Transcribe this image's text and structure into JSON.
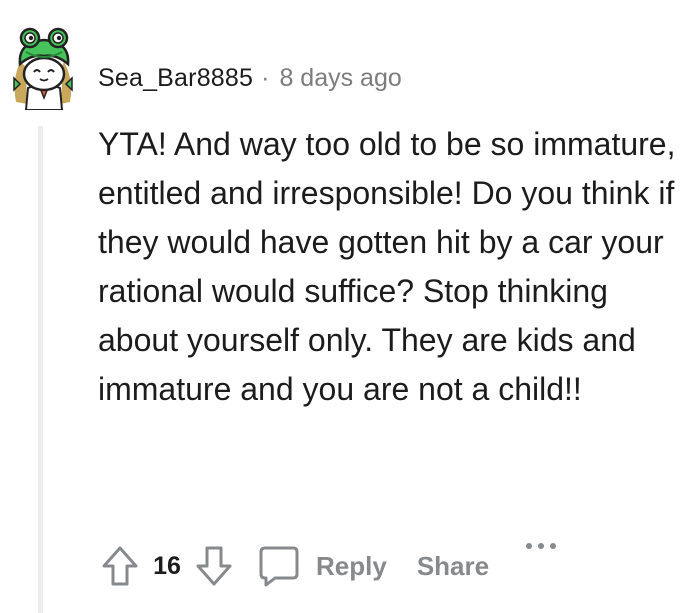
{
  "comment": {
    "author": "Sea_Bar8885",
    "separator": "·",
    "timestamp": "8 days ago",
    "body": "YTA! And way too old to be so immature, entitled and irresponsible! Do you think if they would have gotten hit by a car your rational would suffice? Stop thinking about yourself only. They are kids and immature and you are not a child!!",
    "score": "16"
  },
  "actions": {
    "upvote_icon": "arrow-up-icon",
    "downvote_icon": "arrow-down-icon",
    "reply_icon": "speech-bubble-icon",
    "reply_label": "Reply",
    "share_label": "Share",
    "more_icon": "ellipsis-icon"
  },
  "colors": {
    "text": "#1c1c1c",
    "meta": "#7c7c7c",
    "action": "#878a8c",
    "thread_line": "#ededed",
    "avatar_green": "#46c35b",
    "avatar_hair": "#c9a85c"
  }
}
